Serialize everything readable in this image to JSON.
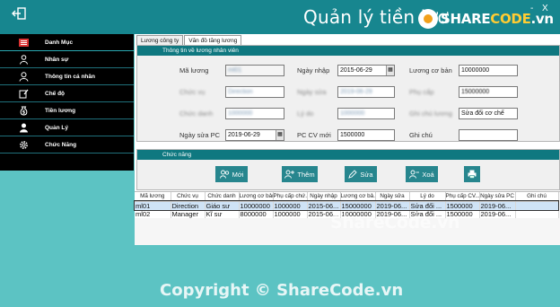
{
  "app": {
    "title": "Quản lý tiền lươ",
    "minimize": "-",
    "close": "X"
  },
  "logo": {
    "part1": "SHARE",
    "part2": "CODE",
    "part3": ".vn"
  },
  "sidebar": {
    "items": [
      {
        "label": "Danh Mục",
        "icon": "list-icon"
      },
      {
        "label": "Nhân sự",
        "icon": "staff-icon"
      },
      {
        "label": "Thông tin cá nhân",
        "icon": "person-icon"
      },
      {
        "label": "Chế độ",
        "icon": "edit-icon"
      },
      {
        "label": "Tiền lương",
        "icon": "money-bag-icon"
      },
      {
        "label": "Quản Lý",
        "icon": "manager-icon"
      },
      {
        "label": "Chức Năng",
        "icon": "gear-icon"
      }
    ]
  },
  "tabs": [
    "Lương công ty",
    "Văn đồ tăng lương"
  ],
  "info_group": {
    "title": "Thông tin về lương nhân viên",
    "labels": {
      "ma_luong": "Mã lương",
      "ngay_nhap": "Ngày nhập",
      "luong_co_ban": "Lương cơ bản",
      "ngay_sua_pc": "Ngày sửa PC",
      "pc_cv_moi": "PC CV mới",
      "ghi_chu": "Ghi chú",
      "blur_a": "Chức vụ",
      "blur_b": "Ngày sửa",
      "blur_c": "Lý do",
      "blur_d": "Chức danh",
      "blur_e": "Phụ cấp",
      "blur_f": "Ghi chú lương"
    },
    "values": {
      "ma_luong": "ml01",
      "ngay_nhap": "2015-06-29",
      "luong_co_ban": "10000000",
      "luong_2": "15000000",
      "ngay_sua_pc": "2019-06-29",
      "pc_cv_moi": "1500000",
      "ghi_chu": "",
      "ly_do": "Sửa đổi cơ chế",
      "blur_1": "1000000",
      "blur_2": "Direction"
    }
  },
  "actions_group": {
    "title": "Chức năng",
    "buttons": [
      {
        "label": "Mới",
        "icon": "new-users-icon"
      },
      {
        "label": "Thêm",
        "icon": "add-user-icon"
      },
      {
        "label": "Sửa",
        "icon": "pencil-icon"
      },
      {
        "label": "Xoá",
        "icon": "remove-user-icon"
      },
      {
        "label": "",
        "icon": "print-icon"
      }
    ]
  },
  "grid": {
    "columns": [
      "Mã lương",
      "Chức vụ",
      "Chức danh",
      "Lương cơ bản",
      "Phụ cấp chứ...",
      "Ngày nhập",
      "Lương cơ bả...",
      "Ngày sửa",
      "Lý do",
      "Phụ cấp CV...",
      "Ngày sửa PC",
      "Ghi chú"
    ],
    "rows": [
      [
        "ml01",
        "Direction",
        "Giáo sư",
        "10000000",
        "1000000",
        "2015-06...",
        "15000000",
        "2019-06...",
        "Sửa đổi ...",
        "1500000",
        "2019-06...",
        ""
      ],
      [
        "ml02",
        "Manager",
        "Kĩ sư",
        "8000000",
        "1000000",
        "2015-06...",
        "10000000",
        "2019-06...",
        "Sửa đổi ...",
        "1500000",
        "2019-06...",
        ""
      ]
    ]
  },
  "watermark": "ShareCode.vn",
  "copyright": "Copyright © ShareCode.vn"
}
